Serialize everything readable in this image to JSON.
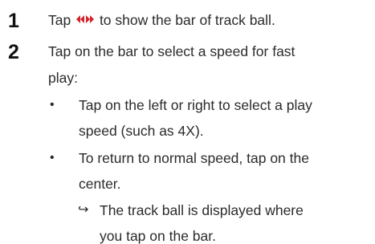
{
  "steps": [
    {
      "number": "1",
      "text_before_icon": "Tap ",
      "icon": "fast-forward-rewind-icon",
      "text_after_icon": " to show the bar of track ball."
    },
    {
      "number": "2",
      "lines": [
        "Tap on the bar to select a speed for fast",
        "play:"
      ],
      "bullets": [
        {
          "lines": [
            "Tap on the left or right to select a play",
            "speed (such as 4X)."
          ]
        },
        {
          "lines": [
            "To return to normal speed, tap on the",
            "center."
          ]
        }
      ],
      "result": {
        "symbol": "↪",
        "lines": [
          "The track ball is displayed where",
          "you tap on the bar."
        ]
      }
    }
  ],
  "colors": {
    "icon_red": "#d2232a",
    "text": "#2b2b2b"
  }
}
